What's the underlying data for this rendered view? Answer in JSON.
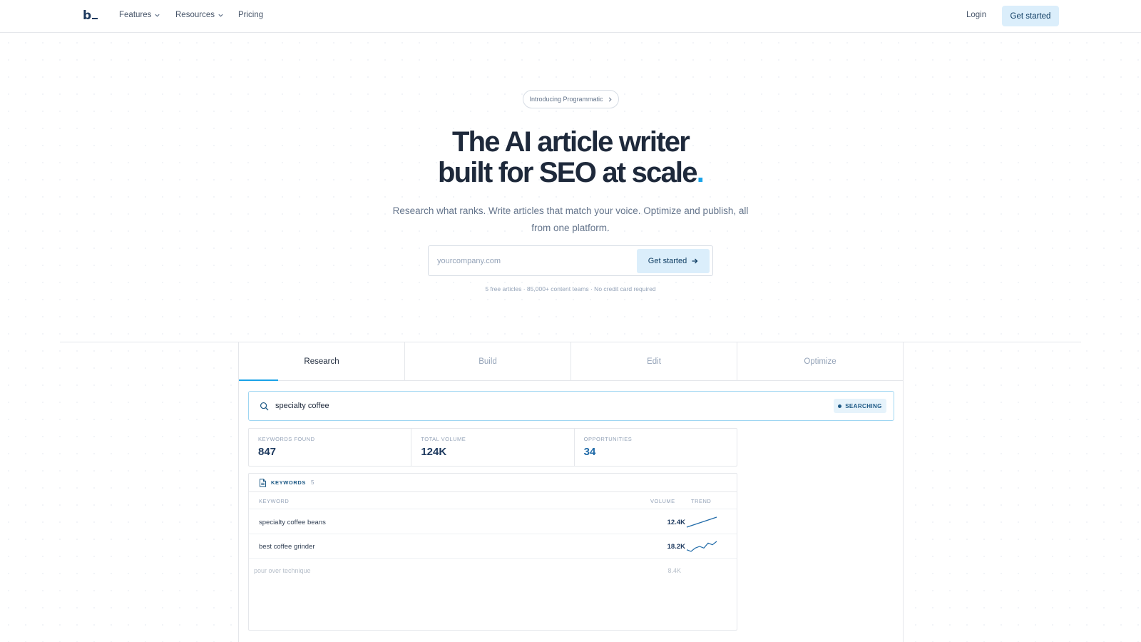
{
  "nav": {
    "logo": "b",
    "links": [
      {
        "label": "Features",
        "has_dropdown": true
      },
      {
        "label": "Resources",
        "has_dropdown": true
      },
      {
        "label": "Pricing",
        "has_dropdown": false
      }
    ],
    "login": "Login",
    "cta": "Get started"
  },
  "hero": {
    "announcement": "Introducing Programmatic",
    "headline_line1": "The AI article writer",
    "headline_line2": "built for SEO at scale",
    "headline_dot": ".",
    "subheadline": "Research what ranks. Write articles that match your voice. Optimize and publish, all from one platform.",
    "input_placeholder": "yourcompany.com",
    "input_value": "",
    "cta": "Get started",
    "fine_print": "5 free articles · 85,000+ content teams · No credit card required"
  },
  "tabs": [
    {
      "label": "Research",
      "active": true
    },
    {
      "label": "Build",
      "active": false
    },
    {
      "label": "Edit",
      "active": false
    },
    {
      "label": "Optimize",
      "active": false
    }
  ],
  "research": {
    "query": "specialty coffee",
    "status": "SEARCHING",
    "stats": [
      {
        "label": "KEYWORDS FOUND",
        "value": "847"
      },
      {
        "label": "TOTAL VOLUME",
        "value": "124K"
      },
      {
        "label": "OPPORTUNITIES",
        "value": "34"
      }
    ],
    "keywords_title": "KEYWORDS",
    "keywords_count": "5",
    "columns": {
      "keyword": "KEYWORD",
      "volume": "VOLUME",
      "trend": "TREND"
    },
    "rows": [
      {
        "keyword": "specialty coffee beans",
        "volume": "12.4K",
        "trend": [
          2,
          3,
          4,
          5,
          6,
          7,
          8,
          9
        ]
      },
      {
        "keyword": "best coffee grinder",
        "volume": "18.2K",
        "trend": [
          3,
          2,
          4,
          5,
          4,
          7,
          6,
          8
        ]
      },
      {
        "keyword": "pour over technique",
        "volume": "8.4K",
        "trend": null
      }
    ]
  },
  "colors": {
    "accent": "#1aa3e8",
    "button_bg": "#dbeefb",
    "brand_dark": "#1e3a5f"
  }
}
